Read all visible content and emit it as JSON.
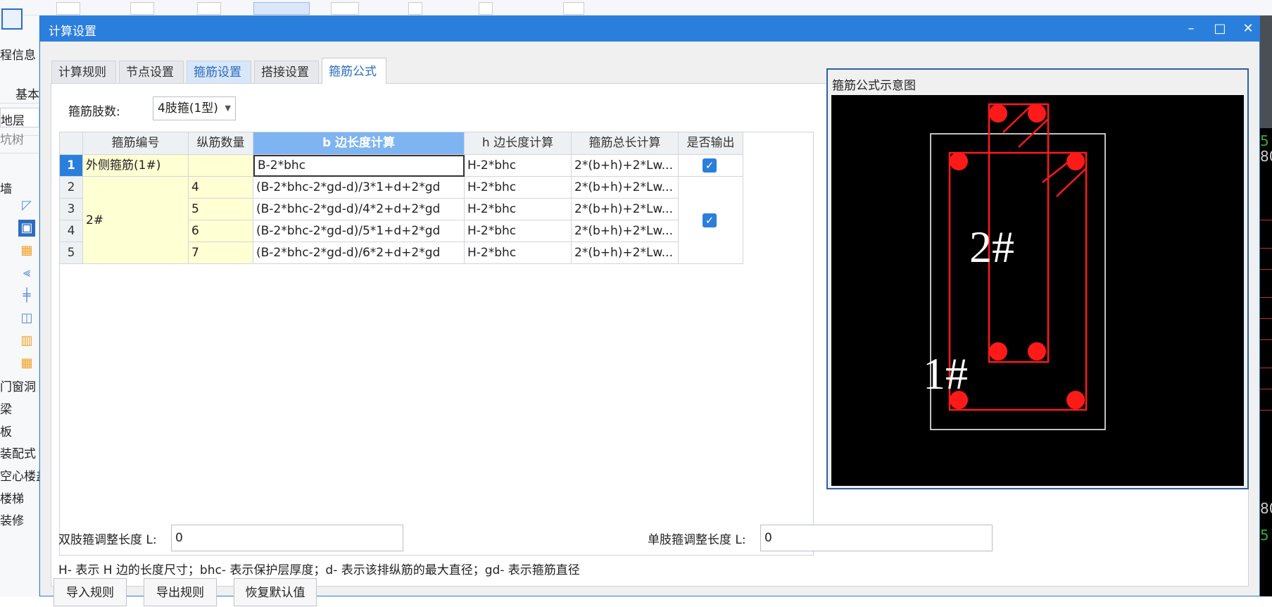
{
  "background": {
    "left_labels": [
      "程信息",
      "基本",
      "地层",
      "坑树",
      "墙",
      "门窗洞",
      "梁",
      "板",
      "装配式",
      "空心楼盖",
      "楼梯",
      "装修"
    ],
    "right_labels": [
      "5",
      "80",
      "80",
      "5"
    ]
  },
  "dialog": {
    "title": "计算设置",
    "minimize": "–",
    "maximize": "□",
    "close": "✕",
    "tabs": [
      "计算规则",
      "节点设置",
      "箍筋设置",
      "搭接设置",
      "箍筋公式"
    ],
    "legs_label": "箍筋肢数:",
    "legs_value": "4肢箍(1型)",
    "columns": [
      "箍筋编号",
      "纵筋数量",
      "b 边长度计算",
      "h 边长度计算",
      "箍筋总长计算",
      "是否输出"
    ],
    "rows": [
      {
        "num": "1",
        "id": "外侧箍筋(1#)",
        "count": "",
        "b": "B-2*bhc",
        "h": "H-2*bhc",
        "total": "2*(b+h)+2*Lw..."
      },
      {
        "num": "2",
        "id": "2#",
        "count": "4",
        "b": "(B-2*bhc-2*gd-d)/3*1+d+2*gd",
        "h": "H-2*bhc",
        "total": "2*(b+h)+2*Lw..."
      },
      {
        "num": "3",
        "id": "",
        "count": "5",
        "b": "(B-2*bhc-2*gd-d)/4*2+d+2*gd",
        "h": "H-2*bhc",
        "total": "2*(b+h)+2*Lw..."
      },
      {
        "num": "4",
        "id": "",
        "count": "6",
        "b": "(B-2*bhc-2*gd-d)/5*1+d+2*gd",
        "h": "H-2*bhc",
        "total": "2*(b+h)+2*Lw..."
      },
      {
        "num": "5",
        "id": "",
        "count": "7",
        "b": "(B-2*bhc-2*gd-d)/6*2+d+2*gd",
        "h": "H-2*bhc",
        "total": "2*(b+h)+2*Lw..."
      }
    ],
    "output_checked": [
      true,
      true
    ],
    "preview_title": "箍筋公式示意图",
    "preview_label_outer": "1#",
    "preview_label_inner": "2#",
    "double_leg_label": "双肢箍调整长度 L:",
    "double_leg_value": "0",
    "single_leg_label": "单肢箍调整长度 L:",
    "single_leg_value": "0",
    "legend": "H- 表示 H 边的长度尺寸；bhc- 表示保护层厚度；d- 表示该排纵筋的最大直径；gd- 表示箍筋直径",
    "buttons": [
      "导入规则",
      "导出规则",
      "恢复默认值"
    ]
  },
  "colors": {
    "titlebar": "#2b7fdc",
    "selected_header": "#7eb4f2",
    "yellow_cell": "#ffffd4",
    "rebar_red": "#ff1a1a"
  }
}
